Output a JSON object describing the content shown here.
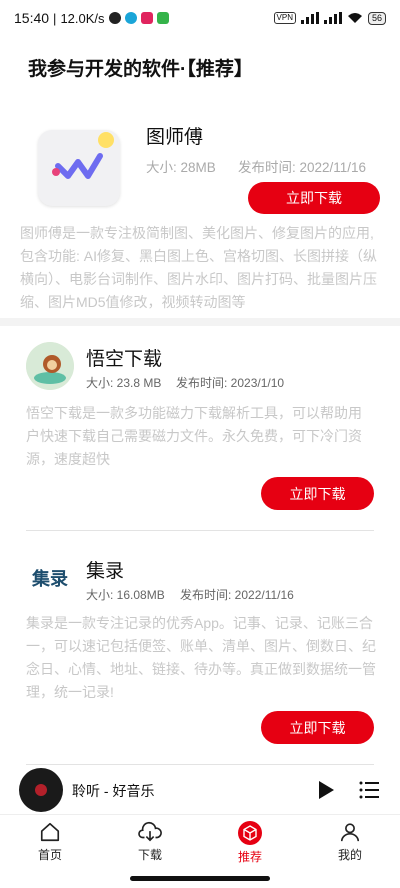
{
  "status_bar": {
    "time": "15:40",
    "network_speed": "12.0K/s",
    "vpn": "VPN",
    "battery": "56"
  },
  "page": {
    "title": "我参与开发的软件·【推荐】"
  },
  "apps": [
    {
      "name": "图师傅",
      "size": "大小: 28MB",
      "date": "发布时间: 2022/11/16",
      "button": "立即下载",
      "description": "图师傅是一款专注极简制图、美化图片、修复图片的应用,包含功能: AI修复、黑白图上色、宫格切图、长图拼接（纵横向）、电影台词制作、图片水印、图片打码、批量图片压缩、图片MD5值修改，视频转动图等"
    },
    {
      "name": "悟空下载",
      "size": "大小: 23.8 MB",
      "date": "发布时间: 2023/1/10",
      "button": "立即下载",
      "description": "悟空下载是一款多功能磁力下载解析工具，可以帮助用户快速下载自己需要磁力文件。永久免费，可下冷门资源，速度超快"
    },
    {
      "name": "集录",
      "logo_text": "集录",
      "size": "大小: 16.08MB",
      "date": "发布时间: 2022/11/16",
      "button": "立即下载",
      "description": "集录是一款专注记录的优秀App。记事、记录、记账三合一，可以速记包括便签、账单、清单、图片、倒数日、纪念日、心情、地址、链接、待办等。真正做到数据统一管理，统一记录!"
    }
  ],
  "player": {
    "title": "聆听 - 好音乐"
  },
  "nav": [
    {
      "label": "首页",
      "icon": "home-icon"
    },
    {
      "label": "下载",
      "icon": "cloud-download-icon"
    },
    {
      "label": "推荐",
      "icon": "cube-icon",
      "active": true
    },
    {
      "label": "我的",
      "icon": "user-icon"
    }
  ],
  "colors": {
    "accent": "#e60012",
    "text": "#111111",
    "muted": "#c8c8c8"
  }
}
